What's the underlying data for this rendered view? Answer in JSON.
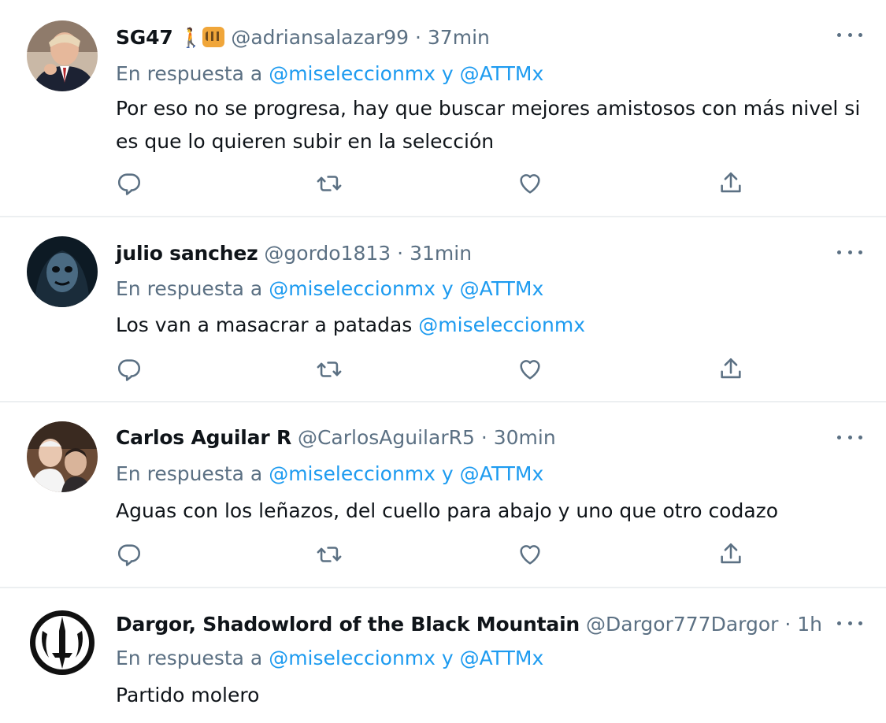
{
  "tweets": [
    {
      "display_name": "SG47",
      "emoji": [
        "🚶",
        "🐯"
      ],
      "handle": "@adriansalazar99",
      "separator": "·",
      "time": "37min",
      "reply_prefix": "En respuesta a",
      "reply_mention_1": "@miseleccionmx",
      "reply_conj": "y",
      "reply_mention_2": "@ATTMx",
      "text": "Por eso no se progresa, hay que buscar mejores amistosos con más nivel si es que lo quieren subir en la selección"
    },
    {
      "display_name": "julio sanchez",
      "handle": "@gordo1813",
      "separator": "·",
      "time": "31min",
      "reply_prefix": "En respuesta a",
      "reply_mention_1": "@miseleccionmx",
      "reply_conj": "y",
      "reply_mention_2": "@ATTMx",
      "text": "Los van a masacrar a patadas",
      "text_mention": "@miseleccionmx"
    },
    {
      "display_name": "Carlos Aguilar R",
      "handle": "@CarlosAguilarR5",
      "separator": "·",
      "time": "30min",
      "reply_prefix": "En respuesta a",
      "reply_mention_1": "@miseleccionmx",
      "reply_conj": "y",
      "reply_mention_2": "@ATTMx",
      "text": "Aguas con los leñazos, del cuello para abajo y uno que otro codazo"
    },
    {
      "display_name": "Dargor, Shadowlord of the Black Mountain",
      "handle": "@Dargor777Dargor",
      "separator": "·",
      "time": "1h",
      "reply_prefix": "En respuesta a",
      "reply_mention_1": "@miseleccionmx",
      "reply_conj": "y",
      "reply_mention_2": "@ATTMx",
      "text": "Partido molero"
    }
  ],
  "icons": {
    "reply": "reply-icon",
    "retweet": "retweet-icon",
    "like": "heart-icon",
    "share": "share-icon",
    "more": "more-icon"
  },
  "colors": {
    "text": "#0f1419",
    "secondary": "#5b7083",
    "mention": "#1d9bf0",
    "divider": "#eceff1"
  }
}
